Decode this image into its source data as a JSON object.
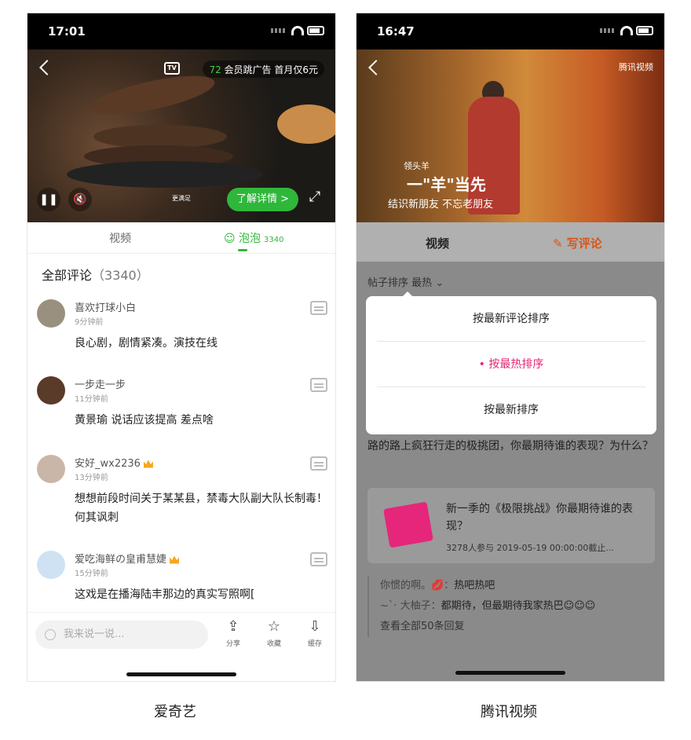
{
  "left_phone": {
    "status_time": "17:01",
    "ad_banner": {
      "seconds": "72",
      "text": "会员跳广告 首月仅6元"
    },
    "tv_icon_text": "TV",
    "video_overlay": {
      "small_text": "更满足",
      "learn_more": "了解详情 >"
    },
    "tabs": [
      {
        "label": "视频"
      },
      {
        "label": "泡泡",
        "count": "3340"
      }
    ],
    "section_title": "全部评论",
    "section_count": "（3340）",
    "comments": [
      {
        "name": "喜欢打球小白",
        "time": "9分钟前",
        "text": "良心剧，剧情紧凑。演技在线",
        "crown": false
      },
      {
        "name": "一步走一步",
        "time": "11分钟前",
        "text": "黄景瑜  说话应该提高  差点啥",
        "crown": false
      },
      {
        "name": "安好_wx2236",
        "time": "13分钟前",
        "text": "想想前段时间关于某某县，禁毒大队副大队长制毒！何其讽刺",
        "crown": true
      },
      {
        "name": "爱吃海鲜の皇甫慧婕",
        "time": "15分钟前",
        "text": "这戏是在播海陆丰那边的真实写照啊[",
        "crown": true
      }
    ],
    "input_placeholder": "我来说一说...",
    "actions": [
      {
        "label": "分享",
        "icon": "share-icon"
      },
      {
        "label": "收藏",
        "icon": "star-icon"
      },
      {
        "label": "缓存",
        "icon": "download-icon"
      }
    ],
    "caption": "爱奇艺"
  },
  "right_phone": {
    "status_time": "16:47",
    "video_overlay": {
      "logo": "腾讯视频",
      "title_small": "领头羊",
      "title_big": "一\"羊\"当先",
      "subtitle": "结识新朋友 不忘老朋友"
    },
    "tabs": {
      "video": "视频",
      "write": "写评论"
    },
    "sort_label": "帖子排序",
    "sort_value": "最热",
    "sort_options": [
      {
        "label": "按最新评论排序",
        "selected": false
      },
      {
        "label": "• 按最热排序",
        "selected": true
      },
      {
        "label": "按最新排序",
        "selected": false
      }
    ],
    "post_text": "路的路上疯狂行走的极挑团，你最期待谁的表现？为什么？",
    "card": {
      "title": "新一季的《极限挑战》你最期待谁的表现？",
      "meta": "3278人参与  2019-05-19 00:00:00截止..."
    },
    "replies": [
      {
        "who": "你惯的啊。💋：",
        "text": "热吧热吧"
      },
      {
        "who": "~`· 大柚子：",
        "text": "都期待，但最期待我家热巴☺☺☺"
      }
    ],
    "see_all": "查看全部50条回复",
    "caption": "腾讯视频"
  },
  "colors": {
    "iqiyi_green": "#2fb73b",
    "tencent_orange": "#d95418",
    "tencent_pink": "#e5267a"
  }
}
